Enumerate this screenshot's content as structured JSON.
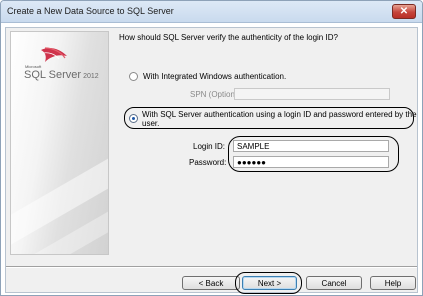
{
  "window": {
    "title": "Create a New Data Source to SQL Server",
    "close_glyph": "✕"
  },
  "branding": {
    "small_text": "Microsoft",
    "product": "SQL Server",
    "version": "2012",
    "icon": "sql-server-logo-icon"
  },
  "auth": {
    "question": "How should SQL Server verify the authenticity of the login ID?",
    "windows_option": {
      "label": "With Integrated Windows authentication.",
      "selected": false
    },
    "spn_label": "SPN (Optional):",
    "spn_value": "",
    "sql_option": {
      "label_line1": "With SQL Server authentication using a login ID and password entered by the",
      "label_line2": "user.",
      "selected": true
    }
  },
  "credentials": {
    "login_label": "Login ID:",
    "login_value": "SAMPLE",
    "password_label": "Password:",
    "password_value": "●●●●●●"
  },
  "buttons": {
    "back": "< Back",
    "next": "Next >",
    "cancel": "Cancel",
    "help": "Help"
  }
}
